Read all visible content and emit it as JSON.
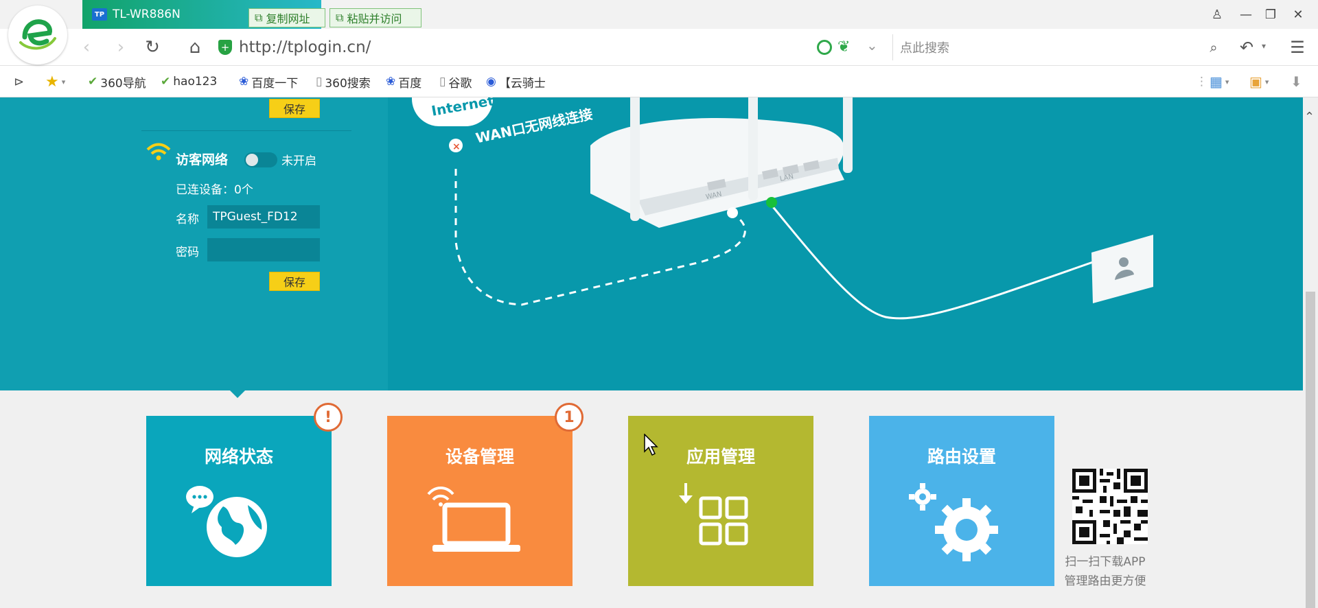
{
  "browser": {
    "tab_title": "TL-WR886N",
    "tab_icon_label": "TP",
    "copy_url_label": "复制网址",
    "paste_visit_label": "粘贴并访问",
    "url": "http://tplogin.cn/",
    "search_placeholder": "点此搜索",
    "bookmarks": [
      {
        "label": "360导航",
        "icon": "hao-check-icon"
      },
      {
        "label": "hao123",
        "icon": "hao-check-icon"
      },
      {
        "label": "百度一下",
        "icon": "paw-icon"
      },
      {
        "label": "360搜索",
        "icon": "page-icon"
      },
      {
        "label": "百度",
        "icon": "paw-icon"
      },
      {
        "label": "谷歌",
        "icon": "page-icon"
      },
      {
        "label": "【云骑士",
        "icon": "globe-icon"
      }
    ]
  },
  "router": {
    "save_label": "保存",
    "guest_network": {
      "title": "访客网络",
      "status": "未开启",
      "enabled": false,
      "connected_devices": "已连设备：0个",
      "name_label": "名称",
      "name_value": "TPGuest_FD12",
      "password_label": "密码",
      "password_value": ""
    },
    "hero": {
      "internet_label": "Internet",
      "wan_status": "WAN口无网线连接",
      "wan_port_label": "WAN",
      "lan_port_label": "LAN"
    },
    "tiles": [
      {
        "title": "网络状态",
        "badge": "!",
        "color": "#0aa6bc",
        "icon": "globe-chat-icon"
      },
      {
        "title": "设备管理",
        "badge": "1",
        "color": "#f98b3f",
        "icon": "wifi-laptop-icon"
      },
      {
        "title": "应用管理",
        "badge": "",
        "color": "#b4b830",
        "icon": "app-grid-icon"
      },
      {
        "title": "路由设置",
        "badge": "",
        "color": "#4bb3e9",
        "icon": "gear-icon"
      }
    ],
    "qr_text_line1": "扫一扫下载APP",
    "qr_text_line2": "管理路由更方便"
  }
}
